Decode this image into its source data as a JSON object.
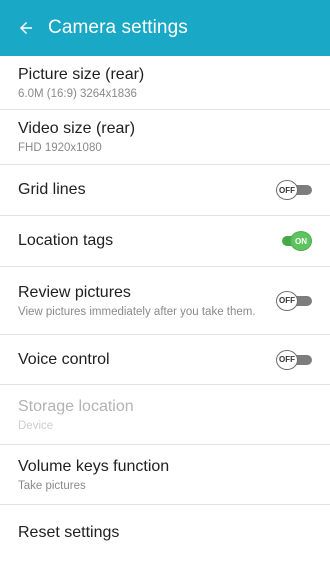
{
  "appbar": {
    "title": "Camera settings",
    "back_icon": "arrow-left-icon",
    "color": "#19a8c6"
  },
  "settings": [
    {
      "label": "Picture size (rear)",
      "sub": "6.0M (16:9) 3264x1836"
    },
    {
      "label": "Video size (rear)",
      "sub": "FHD 1920x1080"
    },
    {
      "label": "Grid lines",
      "toggle": "OFF"
    },
    {
      "label": "Location tags",
      "toggle": "ON"
    },
    {
      "label": "Review pictures",
      "sub": "View pictures immediately after you take them.",
      "toggle": "OFF"
    },
    {
      "label": "Voice control",
      "toggle": "OFF"
    },
    {
      "label": "Storage location",
      "sub": "Device"
    },
    {
      "label": "Volume keys function",
      "sub": "Take pictures"
    },
    {
      "label": "Reset settings"
    }
  ],
  "colors": {
    "toggle_on": "#5dc45f",
    "toggle_off": "#7d7d7d"
  }
}
